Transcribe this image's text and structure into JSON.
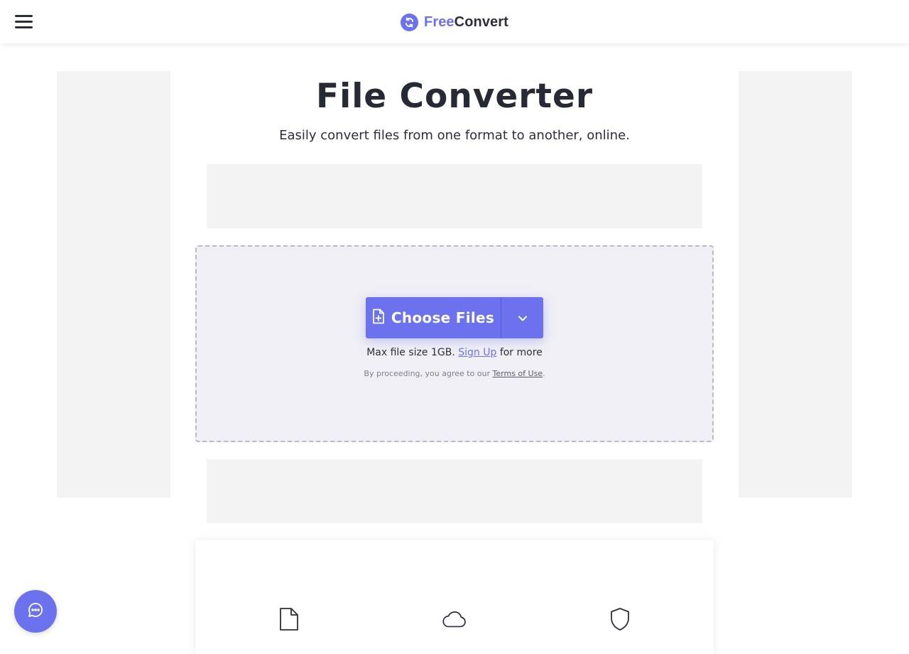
{
  "header": {
    "menu_icon": "hamburger-menu-icon",
    "logo_icon": "refresh-circle-icon",
    "logo_free": "Free",
    "logo_convert": "Convert"
  },
  "hero": {
    "title": "File Converter",
    "subtitle": "Easily convert files from one format to another, online."
  },
  "upload": {
    "choose_label": "Choose Files",
    "choose_icon": "file-plus-icon",
    "dropdown_icon": "chevron-down-icon",
    "max_size_prefix": "Max file size 1GB.",
    "signup_link": "Sign Up",
    "max_size_suffix": "for more",
    "terms_prefix": "By proceeding, you agree to our",
    "terms_link": "Terms of Use",
    "terms_suffix": "."
  },
  "features": {
    "icons": [
      "file-icon",
      "cloud-icon",
      "shield-icon"
    ]
  },
  "chat": {
    "icon": "chat-bubble-icon"
  },
  "colors": {
    "accent": "#6c72ee",
    "text": "#2b2f3a",
    "ad_placeholder": "#f3f3f4",
    "dropzone_bg": "#efeff5"
  }
}
